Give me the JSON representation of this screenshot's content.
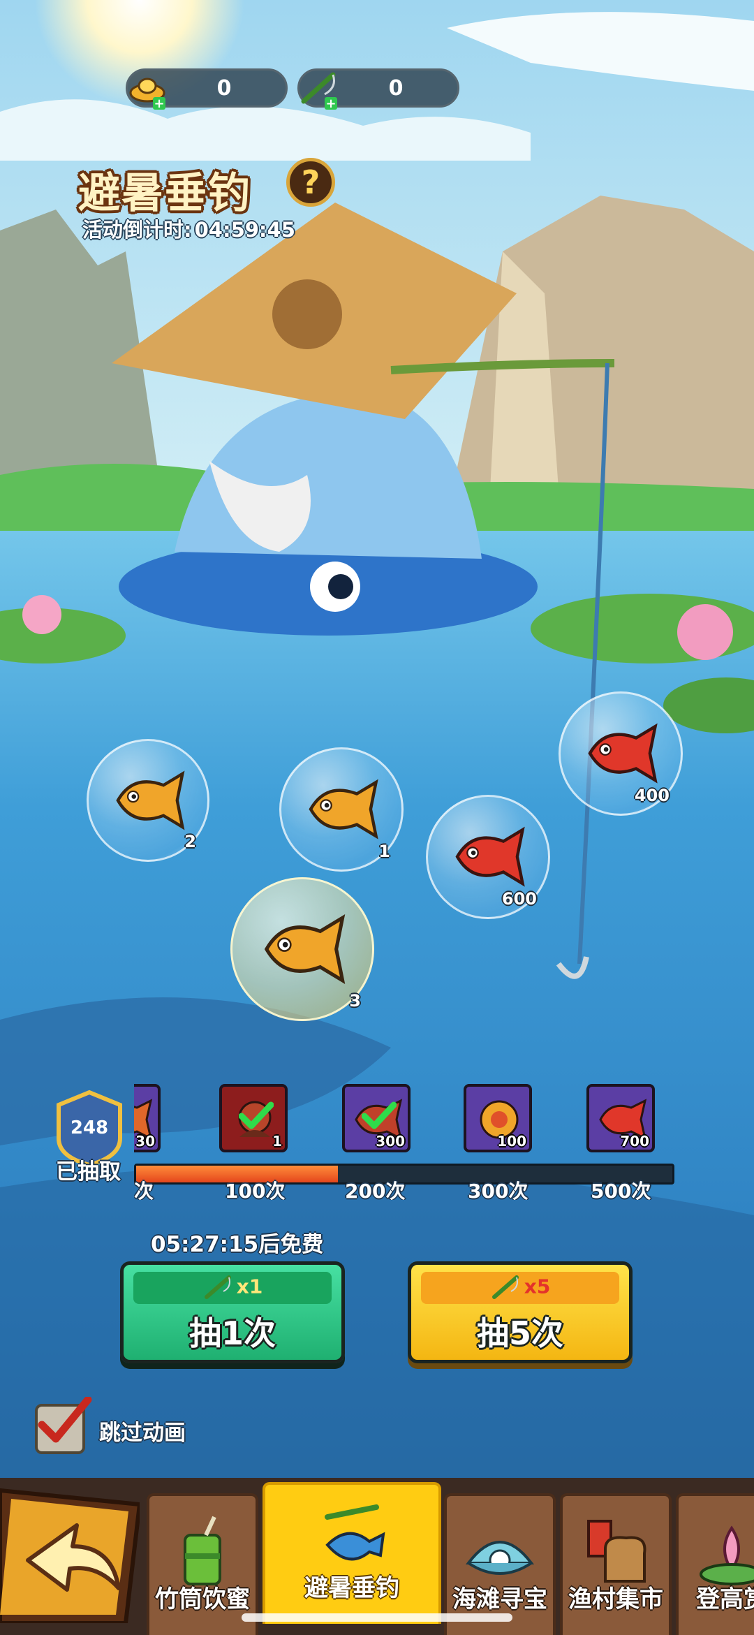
{
  "currencies": [
    {
      "icon": "gold-ingot-icon",
      "value": "0"
    },
    {
      "icon": "fishing-rod-icon",
      "value": "0"
    }
  ],
  "event": {
    "title": "避暑垂钓",
    "countdown_label": "活动倒计时:",
    "countdown_value": "04:59:45"
  },
  "bubbles": [
    {
      "fish": "golden-carp",
      "count": "2"
    },
    {
      "fish": "golden-carp",
      "count": "1"
    },
    {
      "fish": "red-carp",
      "count": "600"
    },
    {
      "fish": "red-carp",
      "count": "400"
    },
    {
      "fish": "golden-carp",
      "count": "3"
    }
  ],
  "draw_counter": {
    "count": "248",
    "label": "已抽取"
  },
  "milestones": {
    "rewards": [
      {
        "amount": "30",
        "claimed": false
      },
      {
        "amount": "1",
        "claimed": true
      },
      {
        "amount": "300",
        "claimed": true
      },
      {
        "amount": "100",
        "claimed": false
      },
      {
        "amount": "700",
        "claimed": false
      }
    ],
    "labels": [
      "次",
      "100次",
      "200次",
      "300次",
      "500次"
    ],
    "progress_fraction": 0.376
  },
  "free_timer": "05:27:15后免费",
  "draw_buttons": {
    "single": {
      "cost": "x1",
      "label": "抽1次"
    },
    "multi": {
      "cost": "x5",
      "label": "抽5次"
    }
  },
  "skip_animation": {
    "label": "跳过动画",
    "checked": true
  },
  "nav": {
    "tabs": [
      {
        "label": "竹筒饮蜜",
        "active": false
      },
      {
        "label": "避暑垂钓",
        "active": true
      },
      {
        "label": "海滩寻宝",
        "active": false
      },
      {
        "label": "渔村集市",
        "active": false
      },
      {
        "label": "登高赏",
        "active": false
      }
    ]
  },
  "colors": {
    "progress": "#f0541f",
    "green_button": "#2fc884",
    "yellow_button": "#ffd424",
    "active_tab": "#ffcc12"
  }
}
